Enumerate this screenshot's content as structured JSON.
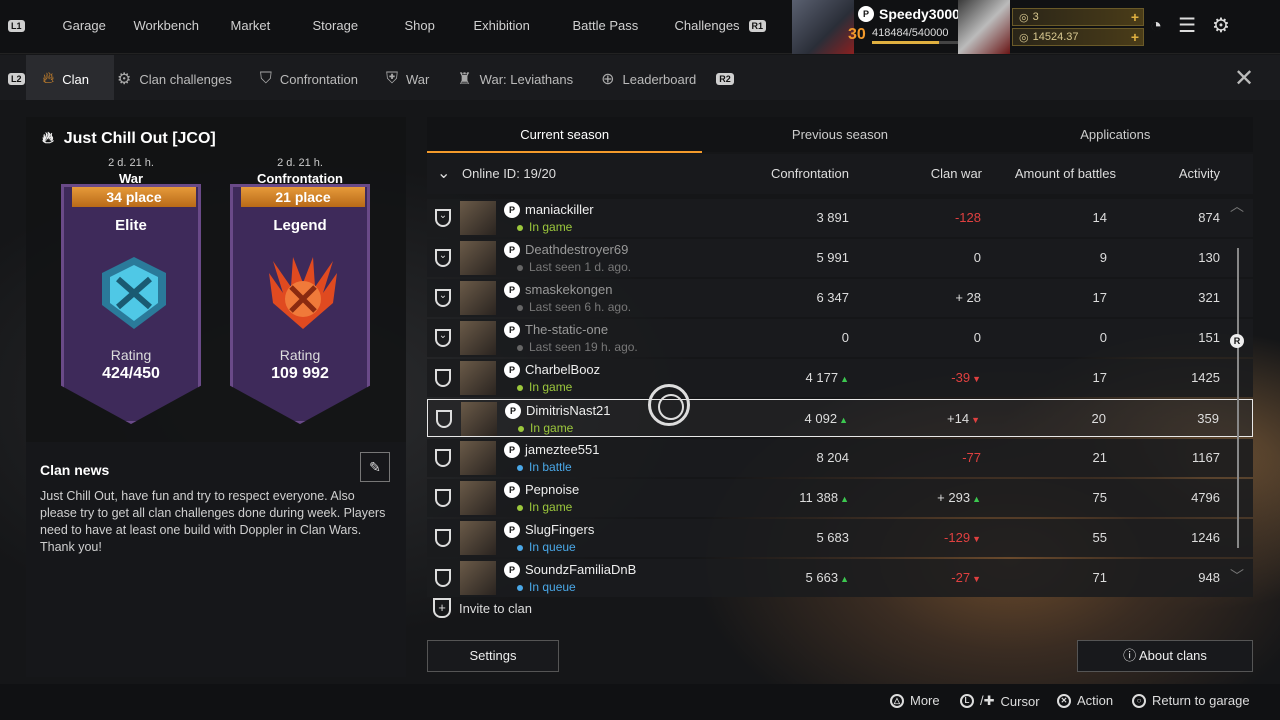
{
  "top_nav": {
    "l1": "L1",
    "r1": "R1",
    "items": [
      "Garage",
      "Workbench",
      "Market",
      "Storage",
      "Shop",
      "Exhibition",
      "Battle Pass",
      "Challenges"
    ]
  },
  "profile": {
    "name": "Speedy3000",
    "level": "30",
    "xp": "418484/540000",
    "xp_progress": 0.775,
    "currency1": "3",
    "currency2": "14524.37"
  },
  "tabs": {
    "l2": "L2",
    "r2": "R2",
    "items": [
      {
        "label": "Clan",
        "icon": "flame-icon"
      },
      {
        "label": "Clan challenges",
        "icon": "challenge-gear-icon"
      },
      {
        "label": "Confrontation",
        "icon": "confrontation-shield-icon"
      },
      {
        "label": "War",
        "icon": "war-shield-icon"
      },
      {
        "label": "War: Leviathans",
        "icon": "leviathan-icon"
      },
      {
        "label": "Leaderboard",
        "icon": "leaderboard-icon"
      }
    ]
  },
  "clan": {
    "name": "Just Chill Out [JCO]",
    "war": {
      "time": "2 d. 21 h.",
      "title": "War",
      "place": "34 place",
      "rank": "Elite",
      "rating_label": "Rating",
      "rating": "424/450",
      "color": "#3fb8d8"
    },
    "confrontation": {
      "time": "2 d. 21 h.",
      "title": "Confrontation",
      "place": "21 place",
      "rank": "Legend",
      "rating_label": "Rating",
      "rating": "109 992",
      "color": "#f05a28"
    }
  },
  "news": {
    "title": "Clan news",
    "text": "Just Chill Out, have fun and try to respect everyone. Also please try to get all clan challenges done during week. Players need to have at least one build with Doppler in Clan Wars. Thank you!"
  },
  "season_tabs": [
    "Current season",
    "Previous season",
    "Applications"
  ],
  "columns": {
    "online": "Online ID: 19/20",
    "confrontation": "Confrontation",
    "clan_war": "Clan war",
    "battles": "Amount of battles",
    "activity": "Activity"
  },
  "members": [
    {
      "name": "maniackiller",
      "status": "In game",
      "status_color": "#9cc83c",
      "conf": "3 891",
      "conf_trend": "",
      "war": "-128",
      "war_trend": "",
      "war_neg": true,
      "battles": "14",
      "activity": "874"
    },
    {
      "name": "Deathdestroyer69",
      "status": "Last seen 1 d. ago.",
      "status_color": "#666666",
      "conf": "5 991",
      "conf_trend": "",
      "war": "0",
      "war_trend": "",
      "war_neg": false,
      "battles": "9",
      "activity": "130"
    },
    {
      "name": "smaskekongen",
      "status": "Last seen 6 h. ago.",
      "status_color": "#666666",
      "conf": "6 347",
      "conf_trend": "",
      "war": "+ 28",
      "war_trend": "",
      "war_neg": false,
      "battles": "17",
      "activity": "321"
    },
    {
      "name": "The-static-one",
      "status": "Last seen 19 h. ago.",
      "status_color": "#666666",
      "conf": "0",
      "conf_trend": "",
      "war": "0",
      "war_trend": "",
      "war_neg": false,
      "battles": "0",
      "activity": "151"
    },
    {
      "name": "CharbelBooz",
      "status": "In game",
      "status_color": "#9cc83c",
      "conf": "4 177",
      "conf_trend": "up",
      "war": "-39",
      "war_trend": "down",
      "war_neg": true,
      "battles": "17",
      "activity": "1425"
    },
    {
      "name": "DimitrisNast21",
      "status": "In game",
      "status_color": "#9cc83c",
      "conf": "4 092",
      "conf_trend": "up",
      "war": "+14",
      "war_trend": "down",
      "war_neg": false,
      "battles": "20",
      "activity": "359"
    },
    {
      "name": "jameztee551",
      "status": "In battle",
      "status_color": "#4aa8e8",
      "conf": "8 204",
      "conf_trend": "",
      "war": "-77",
      "war_trend": "",
      "war_neg": true,
      "battles": "21",
      "activity": "1167"
    },
    {
      "name": "Pepnoise",
      "status": "In game",
      "status_color": "#9cc83c",
      "conf": "11 388",
      "conf_trend": "up",
      "war": "+ 293",
      "war_trend": "up",
      "war_neg": false,
      "battles": "75",
      "activity": "4796"
    },
    {
      "name": "SlugFingers",
      "status": "In queue",
      "status_color": "#4aa8e8",
      "conf": "5 683",
      "conf_trend": "",
      "war": "-129",
      "war_trend": "down",
      "war_neg": true,
      "battles": "55",
      "activity": "1246"
    },
    {
      "name": "SoundzFamiliaDnB",
      "status": "In queue",
      "status_color": "#4aa8e8",
      "conf": "5 663",
      "conf_trend": "up",
      "war": "-27",
      "war_trend": "down",
      "war_neg": true,
      "battles": "71",
      "activity": "948"
    }
  ],
  "invite_label": "Invite to clan",
  "settings_label": "Settings",
  "about_label": "About clans",
  "footer": {
    "more": "More",
    "cursor": "Cursor",
    "action": "Action",
    "return": "Return to garage"
  }
}
